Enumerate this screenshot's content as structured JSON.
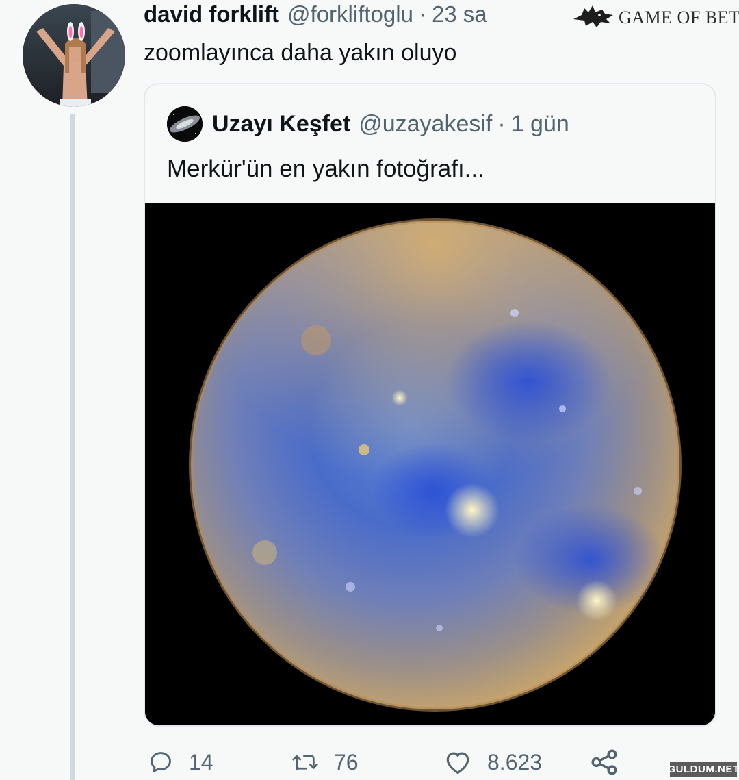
{
  "tweet": {
    "display_name": "david forklift",
    "handle": "@forkliftoglu",
    "separator": "·",
    "time": "23 sa",
    "text": "zoomlayınca daha yakın oluyo"
  },
  "quoted_tweet": {
    "display_name": "Uzayı Keşfet",
    "handle": "@uzayakesif",
    "separator": "·",
    "time": "1 gün",
    "text": "Merkür'ün en yakın fotoğrafı..."
  },
  "actions": {
    "reply": {
      "icon": "reply-icon",
      "count": "14"
    },
    "retweet": {
      "icon": "retweet-icon",
      "count": "76"
    },
    "like": {
      "icon": "heart-icon",
      "count": "8.623"
    },
    "share": {
      "icon": "share-icon"
    }
  },
  "watermarks": {
    "top": "GAME OF BET",
    "bottom": "GULDUM.NET"
  },
  "colors": {
    "background": "#f7f9f9",
    "primary_text": "#0f1419",
    "secondary_text": "#536471",
    "border": "#e1e8ed",
    "thread_line": "#cfd9de"
  }
}
